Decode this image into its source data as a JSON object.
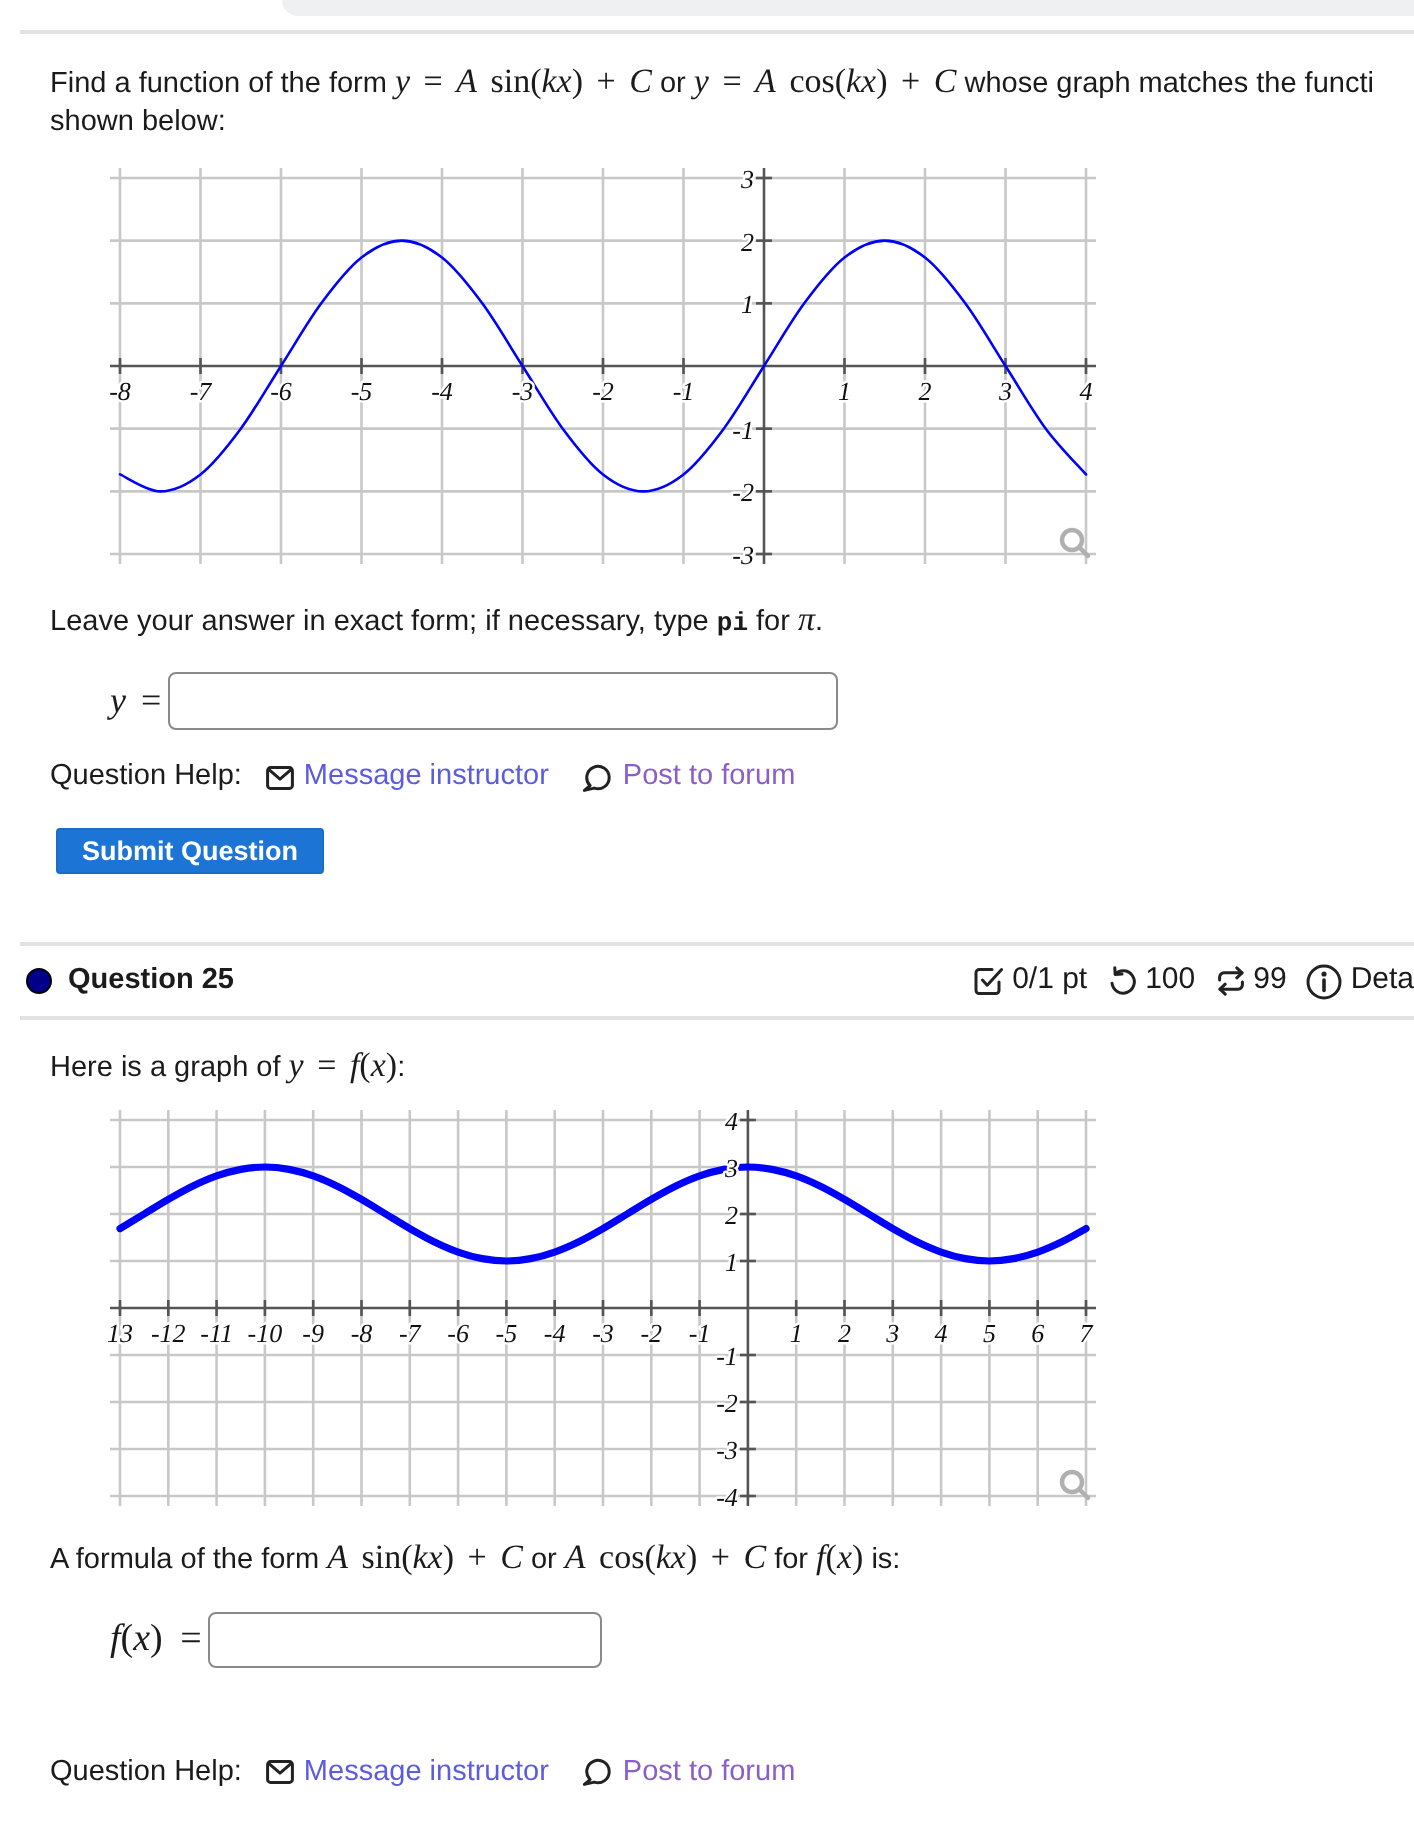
{
  "questions": [
    {
      "prompt": {
        "lines": [
          [
            {
              "kind": "text",
              "text": "Find a function of the form "
            },
            {
              "kind": "math",
              "text": "*y* = *A* sin(*kx*) + *C*"
            },
            {
              "kind": "text",
              "text": " or "
            },
            {
              "kind": "math",
              "text": "*y* = *A* cos(*kx*) + *C*"
            },
            {
              "kind": "text",
              "text": " whose graph matches the functi"
            }
          ],
          [
            {
              "kind": "text",
              "text": "shown below:"
            }
          ]
        ]
      },
      "graph": {
        "chart_data": {
          "type": "line",
          "grid": true,
          "x": [
            -8,
            -7.5,
            -7,
            -6.5,
            -6,
            -5.5,
            -5,
            -4.5,
            -4,
            -3.5,
            -3,
            -2.5,
            -2,
            -1.5,
            -1,
            -0.5,
            0,
            0.5,
            1,
            1.5,
            2,
            2.5,
            3,
            3.5,
            4
          ],
          "series": [
            {
              "color": "#0000ff",
              "values": [
                -1.73,
                -2,
                -1.73,
                -1,
                0,
                1,
                1.73,
                2,
                1.73,
                1,
                0,
                -1,
                -1.73,
                -2,
                -1.73,
                -1,
                0,
                1,
                1.73,
                2,
                1.73,
                1,
                0,
                -1,
                -1.73
              ]
            }
          ],
          "xlim": [
            -8,
            4
          ],
          "ylim": [
            -3,
            3
          ],
          "xticks": [
            -8,
            -7,
            -6,
            -5,
            -4,
            -3,
            -2,
            -1,
            1,
            2,
            3,
            4
          ],
          "yticks": [
            -3,
            -2,
            -1,
            1,
            2,
            3
          ]
        }
      },
      "instructions": [
        {
          "kind": "text",
          "text": "Leave your answer in exact form; if necessary, type "
        },
        {
          "kind": "code",
          "text": "pi"
        },
        {
          "kind": "text",
          "text": " for "
        },
        {
          "kind": "math",
          "text": "*π*"
        },
        {
          "kind": "text",
          "text": "."
        }
      ],
      "answer": {
        "label": "*y* ="
      },
      "help": {
        "label": "Question Help:",
        "links": [
          {
            "kind": "message",
            "text": "Message instructor",
            "visited": false
          },
          {
            "kind": "forum",
            "text": "Post to forum",
            "visited": true
          }
        ]
      },
      "submit_button": "Submit Question"
    },
    {
      "header": {
        "title": "Question 25",
        "stats": [
          {
            "kind": "score",
            "text": "0/1 pt"
          },
          {
            "kind": "attempts",
            "text": "100"
          },
          {
            "kind": "retries",
            "text": "99"
          },
          {
            "kind": "details",
            "text": "Deta"
          }
        ]
      },
      "prompt": {
        "lines": [
          [
            {
              "kind": "text",
              "text": "Here is a graph of "
            },
            {
              "kind": "math",
              "text": "*y* = *f*(*x*)"
            },
            {
              "kind": "text",
              "text": ":"
            }
          ]
        ]
      },
      "graph": {
        "chart_data": {
          "type": "line",
          "grid": true,
          "x": [
            -13,
            -12.5,
            -12,
            -11.5,
            -11,
            -10.5,
            -10,
            -9.5,
            -9,
            -8.5,
            -8,
            -7.5,
            -7,
            -6.5,
            -6,
            -5.5,
            -5,
            -4.5,
            -4,
            -3.5,
            -3,
            -2.5,
            -2,
            -1.5,
            -1,
            -0.5,
            0,
            0.5,
            1,
            1.5,
            2,
            2.5,
            3,
            3.5,
            4,
            4.5,
            5,
            5.5,
            6,
            6.5,
            7
          ],
          "series": [
            {
              "color": "#0000ff",
              "values": [
                1.69,
                2,
                2.31,
                2.59,
                2.81,
                2.95,
                3,
                2.95,
                2.81,
                2.59,
                2.31,
                2,
                1.69,
                1.41,
                1.19,
                1.05,
                1,
                1.05,
                1.19,
                1.41,
                1.69,
                2,
                2.31,
                2.59,
                2.81,
                2.95,
                3,
                2.95,
                2.81,
                2.59,
                2.31,
                2,
                1.69,
                1.41,
                1.19,
                1.05,
                1,
                1.05,
                1.19,
                1.41,
                1.69
              ]
            }
          ],
          "xlim": [
            -13,
            7
          ],
          "ylim": [
            -4,
            4
          ],
          "xticks": [
            {
              "value": -13,
              "label": "13"
            },
            -12,
            -11,
            -10,
            -9,
            -8,
            -7,
            -6,
            -5,
            -4,
            -3,
            -2,
            -1,
            1,
            2,
            3,
            4,
            5,
            6,
            7
          ],
          "yticks": [
            -4,
            -3,
            -2,
            -1,
            1,
            2,
            3,
            4
          ]
        }
      },
      "instructions": [
        {
          "kind": "text",
          "text": "A formula of the form "
        },
        {
          "kind": "math",
          "text": "*A* sin(*kx*) + *C*"
        },
        {
          "kind": "text",
          "text": " or "
        },
        {
          "kind": "math",
          "text": "*A* cos(*kx*) + *C*"
        },
        {
          "kind": "text",
          "text": " for "
        },
        {
          "kind": "math",
          "text": "*f*(*x*)"
        },
        {
          "kind": "text",
          "text": " is:"
        }
      ],
      "answer": {
        "label": "*f*(*x*) ="
      },
      "help": {
        "label": "Question Help:",
        "links": [
          {
            "kind": "message",
            "text": "Message instructor",
            "visited": false
          },
          {
            "kind": "forum",
            "text": "Post to forum",
            "visited": true
          }
        ]
      }
    }
  ]
}
